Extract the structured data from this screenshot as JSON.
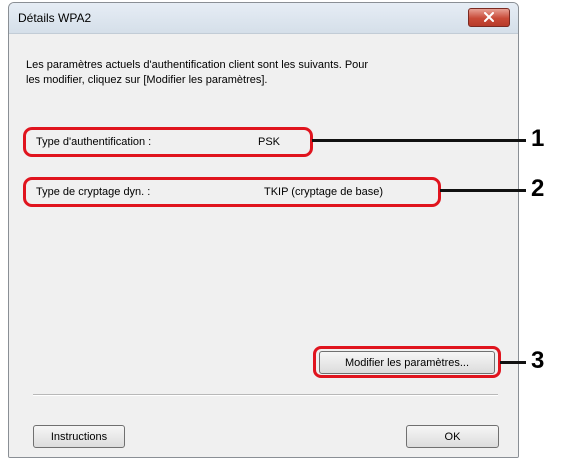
{
  "window": {
    "title": "Détails WPA2"
  },
  "description": "Les paramètres actuels d'authentification client sont les suivants. Pour\nles modifier, cliquez sur [Modifier les paramètres].",
  "fields": [
    {
      "label": "Type d'authentification :",
      "value": "PSK"
    },
    {
      "label": "Type de cryptage dyn. :",
      "value": "TKIP (cryptage de base)"
    }
  ],
  "buttons": {
    "modify": "Modifier les paramètres...",
    "instructions": "Instructions",
    "ok": "OK"
  },
  "callouts": [
    "1",
    "2",
    "3"
  ],
  "colors": {
    "highlight": "#e0141e",
    "close_button": "#c84a37"
  },
  "icons": {
    "close": "close-icon"
  }
}
